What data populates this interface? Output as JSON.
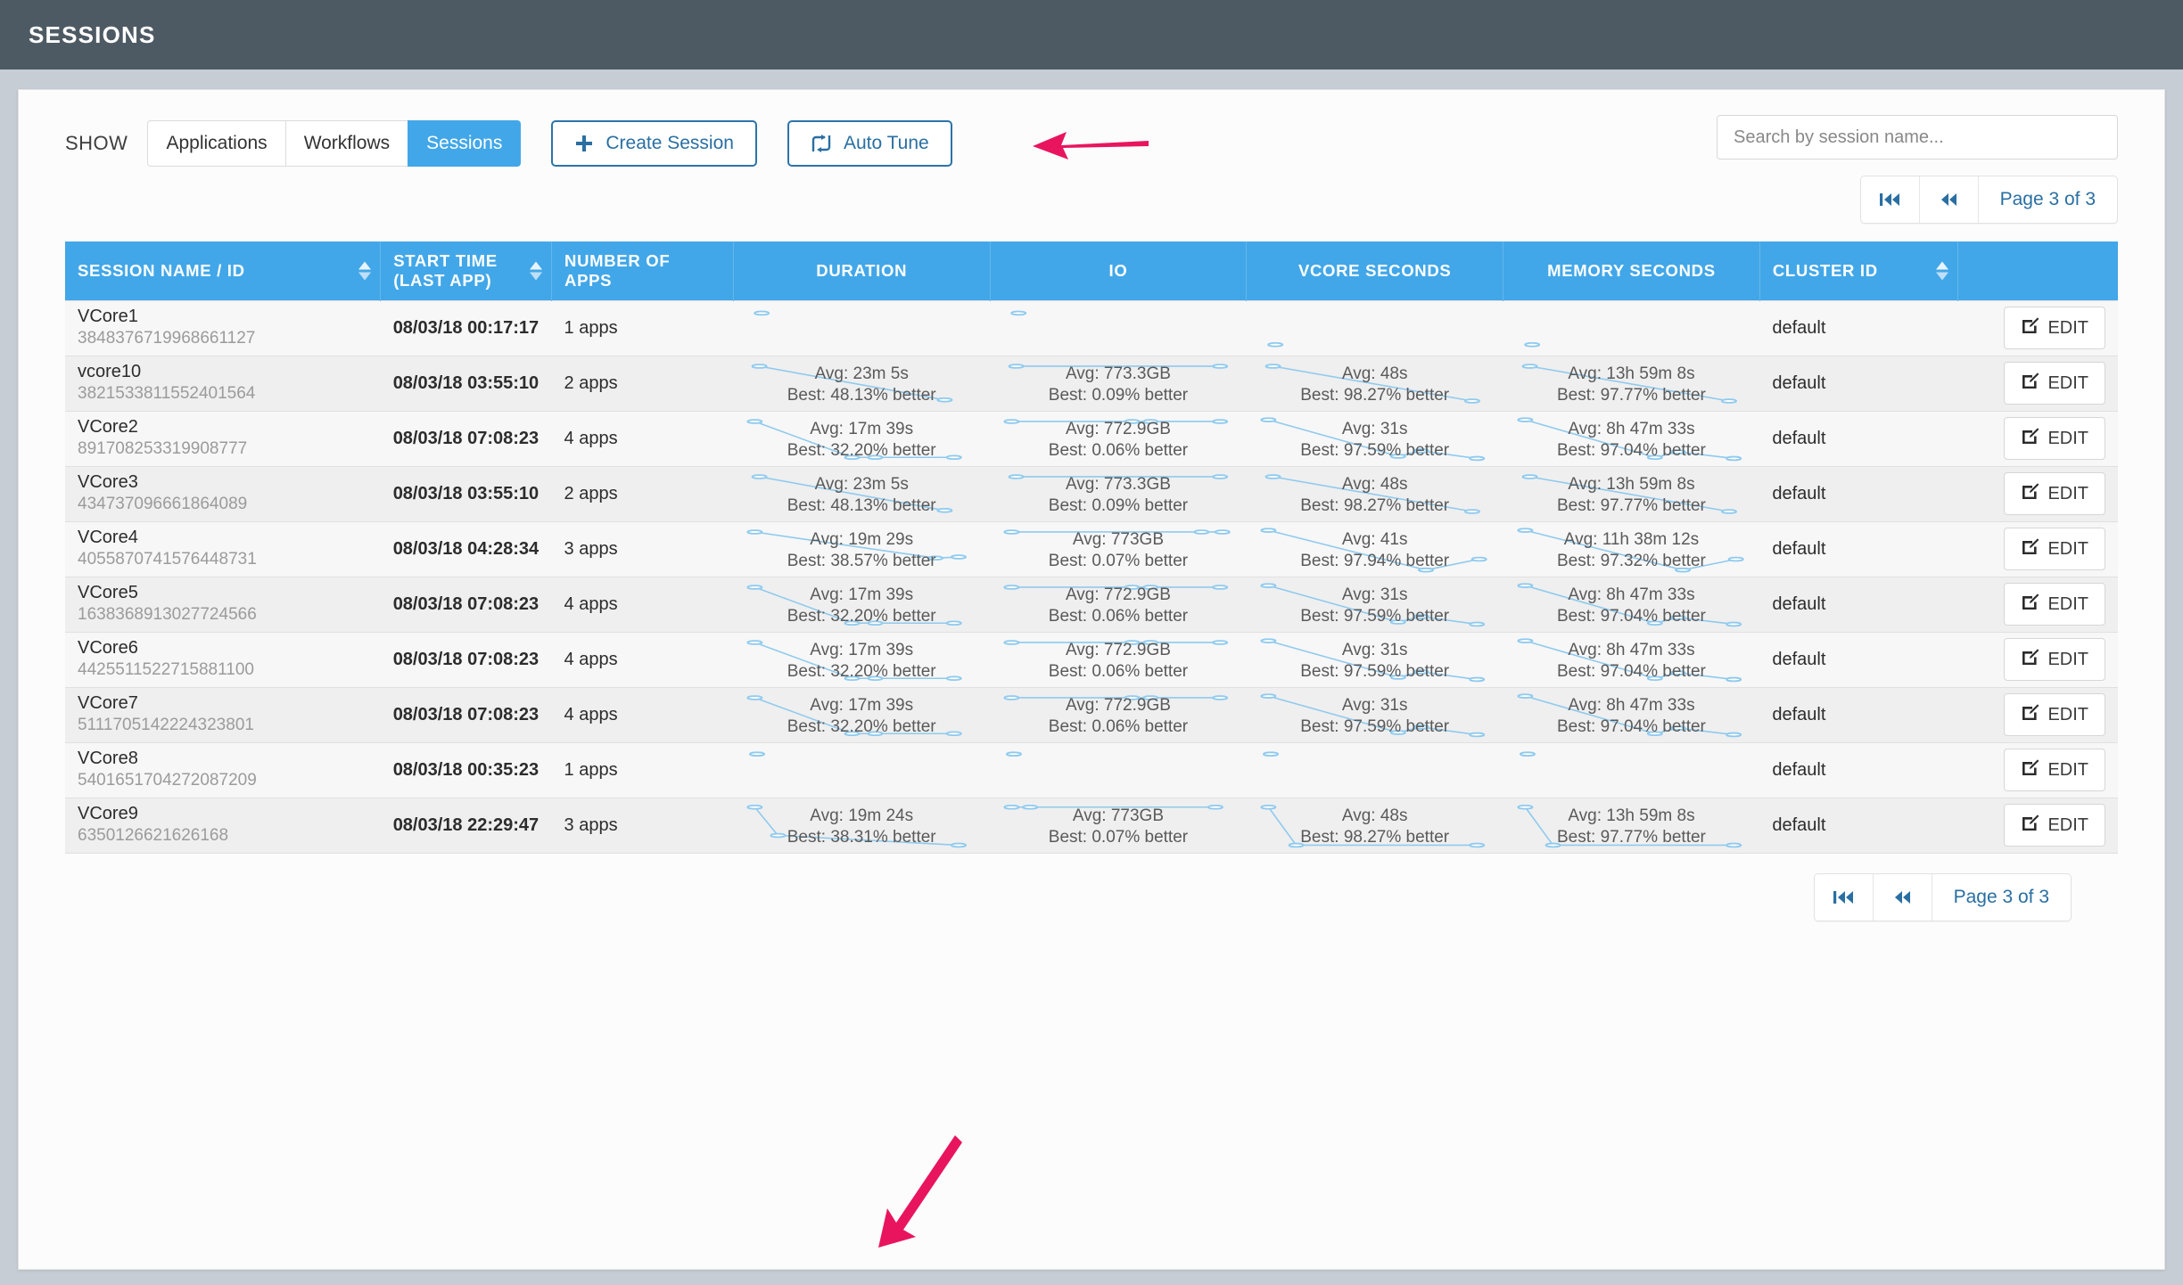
{
  "header": {
    "title": "SESSIONS"
  },
  "toolbar": {
    "show_label": "SHOW",
    "tabs": [
      {
        "label": "Applications",
        "active": false
      },
      {
        "label": "Workflows",
        "active": false
      },
      {
        "label": "Sessions",
        "active": true
      }
    ],
    "create_session_label": "Create Session",
    "auto_tune_label": "Auto Tune",
    "create_icon": "plus-icon",
    "auto_tune_icon": "auto-tune-icon"
  },
  "search": {
    "placeholder": "Search by session name...",
    "value": ""
  },
  "pager": {
    "first_icon": "first-page-icon",
    "prev_icon": "previous-page-icon",
    "label": "Page 3 of 3"
  },
  "table": {
    "columns": [
      {
        "label": "SESSION NAME / ID",
        "sortable": true,
        "align": "left"
      },
      {
        "label": "START TIME (LAST APP)",
        "sortable": true,
        "align": "left"
      },
      {
        "label": "NUMBER OF APPS",
        "sortable": false,
        "align": "left"
      },
      {
        "label": "DURATION",
        "sortable": false,
        "align": "center"
      },
      {
        "label": "IO",
        "sortable": false,
        "align": "center"
      },
      {
        "label": "VCORE SECONDS",
        "sortable": false,
        "align": "center"
      },
      {
        "label": "MEMORY SECONDS",
        "sortable": false,
        "align": "center"
      },
      {
        "label": "CLUSTER ID",
        "sortable": true,
        "align": "left"
      },
      {
        "label": "",
        "sortable": false,
        "align": "right"
      }
    ],
    "edit_label": "EDIT",
    "edit_icon": "edit-pencil-icon",
    "rows": [
      {
        "name": "VCore1",
        "id": "3848376719968661127",
        "start_time": "08/03/18 00:17:17",
        "apps": "1 apps",
        "cluster_id": "default",
        "duration": {
          "avg": "",
          "best": "",
          "points": [
            [
              0.07,
              0.22
            ]
          ]
        },
        "io": {
          "avg": "",
          "best": "",
          "points": [
            [
              0.07,
              0.22
            ]
          ]
        },
        "vcore_seconds": {
          "avg": "",
          "best": "",
          "points": [
            [
              0.07,
              0.8
            ]
          ]
        },
        "memory_seconds": {
          "avg": "",
          "best": "",
          "points": [
            [
              0.07,
              0.8
            ]
          ]
        }
      },
      {
        "name": "vcore10",
        "id": "3821533811552401564",
        "start_time": "08/03/18 03:55:10",
        "apps": "2 apps",
        "cluster_id": "default",
        "duration": {
          "avg": "Avg: 23m 5s",
          "best": "Best: 48.13% better",
          "points": [
            [
              0.06,
              0.18
            ],
            [
              0.86,
              0.8
            ]
          ]
        },
        "io": {
          "avg": "Avg: 773.3GB",
          "best": "Best: 0.09% better",
          "points": [
            [
              0.06,
              0.18
            ],
            [
              0.94,
              0.18
            ]
          ]
        },
        "vcore_seconds": {
          "avg": "Avg: 48s",
          "best": "Best: 98.27% better",
          "points": [
            [
              0.06,
              0.18
            ],
            [
              0.92,
              0.82
            ]
          ]
        },
        "memory_seconds": {
          "avg": "Avg: 13h 59m 8s",
          "best": "Best: 97.77% better",
          "points": [
            [
              0.06,
              0.18
            ],
            [
              0.92,
              0.82
            ]
          ]
        }
      },
      {
        "name": "VCore2",
        "id": "891708253319908777",
        "start_time": "08/03/18 07:08:23",
        "apps": "4 apps",
        "cluster_id": "default",
        "duration": {
          "avg": "Avg: 17m 39s",
          "best": "Best: 32.20% better",
          "points": [
            [
              0.04,
              0.18
            ],
            [
              0.46,
              0.84
            ],
            [
              0.56,
              0.84
            ],
            [
              0.9,
              0.84
            ]
          ]
        },
        "io": {
          "avg": "Avg: 772.9GB",
          "best": "Best: 0.06% better",
          "points": [
            [
              0.04,
              0.18
            ],
            [
              0.56,
              0.18
            ],
            [
              0.64,
              0.18
            ],
            [
              0.94,
              0.18
            ]
          ]
        },
        "vcore_seconds": {
          "avg": "Avg: 31s",
          "best": "Best: 97.59% better",
          "points": [
            [
              0.04,
              0.15
            ],
            [
              0.6,
              0.82
            ],
            [
              0.7,
              0.72
            ],
            [
              0.94,
              0.86
            ]
          ]
        },
        "memory_seconds": {
          "avg": "Avg: 8h 47m 33s",
          "best": "Best: 97.04% better",
          "points": [
            [
              0.04,
              0.15
            ],
            [
              0.6,
              0.84
            ],
            [
              0.7,
              0.74
            ],
            [
              0.94,
              0.86
            ]
          ]
        }
      },
      {
        "name": "VCore3",
        "id": "434737096661864089",
        "start_time": "08/03/18 03:55:10",
        "apps": "2 apps",
        "cluster_id": "default",
        "duration": {
          "avg": "Avg: 23m 5s",
          "best": "Best: 48.13% better",
          "points": [
            [
              0.06,
              0.18
            ],
            [
              0.86,
              0.8
            ]
          ]
        },
        "io": {
          "avg": "Avg: 773.3GB",
          "best": "Best: 0.09% better",
          "points": [
            [
              0.06,
              0.18
            ],
            [
              0.94,
              0.18
            ]
          ]
        },
        "vcore_seconds": {
          "avg": "Avg: 48s",
          "best": "Best: 98.27% better",
          "points": [
            [
              0.06,
              0.18
            ],
            [
              0.92,
              0.82
            ]
          ]
        },
        "memory_seconds": {
          "avg": "Avg: 13h 59m 8s",
          "best": "Best: 97.77% better",
          "points": [
            [
              0.06,
              0.18
            ],
            [
              0.92,
              0.82
            ]
          ]
        }
      },
      {
        "name": "VCore4",
        "id": "4055870741576448731",
        "start_time": "08/03/18 04:28:34",
        "apps": "3 apps",
        "cluster_id": "default",
        "duration": {
          "avg": "Avg: 19m 29s",
          "best": "Best: 38.57% better",
          "points": [
            [
              0.04,
              0.18
            ],
            [
              0.82,
              0.66
            ],
            [
              0.92,
              0.64
            ]
          ]
        },
        "io": {
          "avg": "Avg: 773GB",
          "best": "Best: 0.07% better",
          "points": [
            [
              0.04,
              0.18
            ],
            [
              0.86,
              0.18
            ],
            [
              0.95,
              0.18
            ]
          ]
        },
        "vcore_seconds": {
          "avg": "Avg: 41s",
          "best": "Best: 97.94% better",
          "points": [
            [
              0.04,
              0.15
            ],
            [
              0.72,
              0.88
            ],
            [
              0.95,
              0.68
            ]
          ]
        },
        "memory_seconds": {
          "avg": "Avg: 11h 38m 12s",
          "best": "Best: 97.32% better",
          "points": [
            [
              0.04,
              0.15
            ],
            [
              0.72,
              0.88
            ],
            [
              0.95,
              0.68
            ]
          ]
        }
      },
      {
        "name": "VCore5",
        "id": "1638368913027724566",
        "start_time": "08/03/18 07:08:23",
        "apps": "4 apps",
        "cluster_id": "default",
        "duration": {
          "avg": "Avg: 17m 39s",
          "best": "Best: 32.20% better",
          "points": [
            [
              0.04,
              0.18
            ],
            [
              0.46,
              0.84
            ],
            [
              0.56,
              0.84
            ],
            [
              0.9,
              0.84
            ]
          ]
        },
        "io": {
          "avg": "Avg: 772.9GB",
          "best": "Best: 0.06% better",
          "points": [
            [
              0.04,
              0.18
            ],
            [
              0.56,
              0.18
            ],
            [
              0.64,
              0.18
            ],
            [
              0.94,
              0.18
            ]
          ]
        },
        "vcore_seconds": {
          "avg": "Avg: 31s",
          "best": "Best: 97.59% better",
          "points": [
            [
              0.04,
              0.15
            ],
            [
              0.6,
              0.82
            ],
            [
              0.7,
              0.72
            ],
            [
              0.94,
              0.86
            ]
          ]
        },
        "memory_seconds": {
          "avg": "Avg: 8h 47m 33s",
          "best": "Best: 97.04% better",
          "points": [
            [
              0.04,
              0.15
            ],
            [
              0.6,
              0.84
            ],
            [
              0.7,
              0.74
            ],
            [
              0.94,
              0.86
            ]
          ]
        }
      },
      {
        "name": "VCore6",
        "id": "4425511522715881100",
        "start_time": "08/03/18 07:08:23",
        "apps": "4 apps",
        "cluster_id": "default",
        "duration": {
          "avg": "Avg: 17m 39s",
          "best": "Best: 32.20% better",
          "points": [
            [
              0.04,
              0.18
            ],
            [
              0.46,
              0.84
            ],
            [
              0.56,
              0.84
            ],
            [
              0.9,
              0.84
            ]
          ]
        },
        "io": {
          "avg": "Avg: 772.9GB",
          "best": "Best: 0.06% better",
          "points": [
            [
              0.04,
              0.18
            ],
            [
              0.56,
              0.18
            ],
            [
              0.64,
              0.18
            ],
            [
              0.94,
              0.18
            ]
          ]
        },
        "vcore_seconds": {
          "avg": "Avg: 31s",
          "best": "Best: 97.59% better",
          "points": [
            [
              0.04,
              0.15
            ],
            [
              0.6,
              0.82
            ],
            [
              0.7,
              0.72
            ],
            [
              0.94,
              0.86
            ]
          ]
        },
        "memory_seconds": {
          "avg": "Avg: 8h 47m 33s",
          "best": "Best: 97.04% better",
          "points": [
            [
              0.04,
              0.15
            ],
            [
              0.6,
              0.84
            ],
            [
              0.7,
              0.74
            ],
            [
              0.94,
              0.86
            ]
          ]
        }
      },
      {
        "name": "VCore7",
        "id": "5111705142224323801",
        "start_time": "08/03/18 07:08:23",
        "apps": "4 apps",
        "cluster_id": "default",
        "duration": {
          "avg": "Avg: 17m 39s",
          "best": "Best: 32.20% better",
          "points": [
            [
              0.04,
              0.18
            ],
            [
              0.46,
              0.84
            ],
            [
              0.56,
              0.84
            ],
            [
              0.9,
              0.84
            ]
          ]
        },
        "io": {
          "avg": "Avg: 772.9GB",
          "best": "Best: 0.06% better",
          "points": [
            [
              0.04,
              0.18
            ],
            [
              0.56,
              0.18
            ],
            [
              0.64,
              0.18
            ],
            [
              0.94,
              0.18
            ]
          ]
        },
        "vcore_seconds": {
          "avg": "Avg: 31s",
          "best": "Best: 97.59% better",
          "points": [
            [
              0.04,
              0.15
            ],
            [
              0.6,
              0.82
            ],
            [
              0.7,
              0.72
            ],
            [
              0.94,
              0.86
            ]
          ]
        },
        "memory_seconds": {
          "avg": "Avg: 8h 47m 33s",
          "best": "Best: 97.04% better",
          "points": [
            [
              0.04,
              0.15
            ],
            [
              0.6,
              0.84
            ],
            [
              0.7,
              0.74
            ],
            [
              0.94,
              0.86
            ]
          ]
        }
      },
      {
        "name": "VCore8",
        "id": "5401651704272087209",
        "start_time": "08/03/18 00:35:23",
        "apps": "1 apps",
        "cluster_id": "default",
        "duration": {
          "avg": "",
          "best": "",
          "points": [
            [
              0.05,
              0.2
            ]
          ]
        },
        "io": {
          "avg": "",
          "best": "",
          "points": [
            [
              0.05,
              0.2
            ]
          ]
        },
        "vcore_seconds": {
          "avg": "",
          "best": "",
          "points": [
            [
              0.05,
              0.2
            ]
          ]
        },
        "memory_seconds": {
          "avg": "",
          "best": "",
          "points": [
            [
              0.05,
              0.2
            ]
          ]
        }
      },
      {
        "name": "VCore9",
        "id": "6350126621626168",
        "start_time": "08/03/18 22:29:47",
        "apps": "3 apps",
        "cluster_id": "default",
        "duration": {
          "avg": "Avg: 19m 24s",
          "best": "Best: 38.31% better",
          "points": [
            [
              0.04,
              0.16
            ],
            [
              0.14,
              0.68
            ],
            [
              0.92,
              0.86
            ]
          ]
        },
        "io": {
          "avg": "Avg: 773GB",
          "best": "Best: 0.07% better",
          "points": [
            [
              0.04,
              0.16
            ],
            [
              0.12,
              0.16
            ],
            [
              0.92,
              0.16
            ]
          ]
        },
        "vcore_seconds": {
          "avg": "Avg: 48s",
          "best": "Best: 98.27% better",
          "points": [
            [
              0.04,
              0.16
            ],
            [
              0.16,
              0.86
            ],
            [
              0.94,
              0.86
            ]
          ]
        },
        "memory_seconds": {
          "avg": "Avg: 13h 59m 8s",
          "best": "Best: 97.77% better",
          "points": [
            [
              0.04,
              0.16
            ],
            [
              0.16,
              0.86
            ],
            [
              0.94,
              0.86
            ]
          ]
        }
      }
    ]
  },
  "colors": {
    "accent": "#42a7e8",
    "topbar": "#4e5a63",
    "spark_line": "#8fcaee",
    "link": "#2a6fa2",
    "annotation_arrow": "#e8155e"
  }
}
